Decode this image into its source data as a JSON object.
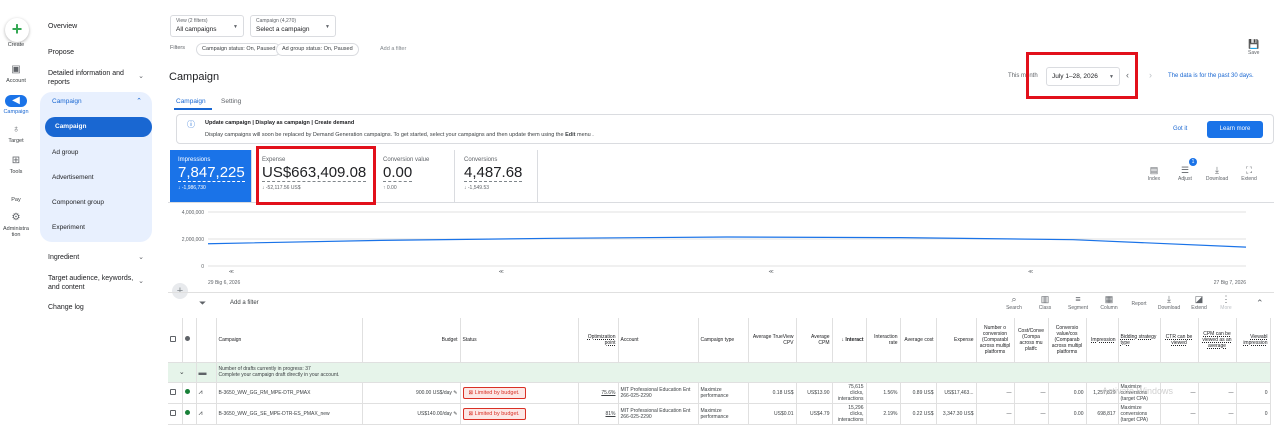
{
  "rail": {
    "create": "Create",
    "items": [
      {
        "label": "Account",
        "icon": "account-icon"
      },
      {
        "label": "Campaign",
        "icon": "campaign-icon"
      },
      {
        "label": "Target",
        "icon": "target-icon"
      },
      {
        "label": "Tools",
        "icon": "tools-icon"
      },
      {
        "label": "Pay",
        "icon": "pay-icon"
      },
      {
        "label": "Administra tion",
        "icon": "admin-icon"
      }
    ]
  },
  "nav": {
    "overview": "Overview",
    "propose": "Propose",
    "detailed": "Detailed information and reports",
    "campaign": "Campaign",
    "sub": [
      "Campaign",
      "Ad group",
      "Advertisement",
      "Component group",
      "Experiment"
    ],
    "ingredient": "Ingredient",
    "target_audience": "Target audience, keywords, and content",
    "change_log": "Change log"
  },
  "header": {
    "view_small": "View (2 filters)",
    "view_value": "All campaigns",
    "campaign_small": "Campaign (4,270)",
    "campaign_value": "Select a campaign",
    "filters_label": "Filters",
    "chip1": "Campaign status: On, Paused",
    "chip2": "Ad group status: On, Paused",
    "add_filter": "Add a filter",
    "save": "Save"
  },
  "page": {
    "title": "Campaign",
    "this_month": "This month",
    "date_range": "July 1–28, 2026",
    "data_note": "The data is for the past 30 days.",
    "tab_campaign": "Campaign",
    "tab_setting": "Setting"
  },
  "banner": {
    "title": "Update campaign | Display as campaign | Create demand",
    "text_a": "Display campaigns will soon be replaced by Demand Generation campaigns. To get started, select your campaigns and then update them using the ",
    "text_bold": "Edit",
    "text_b": " menu .",
    "got_it": "Got it",
    "learn_more": "Learn more"
  },
  "scorecards": [
    {
      "label": "Impressions",
      "value": "7,847,225",
      "delta": "↓ -1,986,730"
    },
    {
      "label": "Expense",
      "value": "US$663,409.08",
      "delta": "↓ -52,117.56 US$"
    },
    {
      "label": "Conversion value",
      "value": "0.00",
      "delta": "↑ 0.00"
    },
    {
      "label": "Conversions",
      "value": "4,487.68",
      "delta": "↓ -1,549.53"
    }
  ],
  "tools": {
    "index": "Index",
    "adjust": "Adjust",
    "adjust_badge": "1",
    "download": "Download",
    "extend": "Extend"
  },
  "chart_data": {
    "type": "line",
    "y_ticks": [
      "4,000,000",
      "2,000,000",
      "0"
    ],
    "ylim": [
      0,
      4000000
    ],
    "x_start": "29 Big 6, 2026",
    "x_end": "27 Big 7, 2026",
    "series": [
      {
        "values": [
          1650000,
          1900000,
          2050000,
          2150000,
          2100000,
          1950000,
          1400000
        ]
      }
    ],
    "color": "#1a73e8",
    "markers": [
      "≪",
      "≪",
      "≪",
      "≪"
    ]
  },
  "table_toolbar": {
    "add_filter": "Add a filter",
    "search": "Search",
    "class": "Class",
    "segment": "Segment",
    "column": "Column",
    "report": "Report",
    "download": "Download",
    "extend": "Extend",
    "more": "More"
  },
  "table": {
    "headers": [
      "Campaign",
      "Budget",
      "Status",
      "Optimization point",
      "Account",
      "Campaign type",
      "Average TrueView CPV",
      "Average CPM",
      "↓ Interact",
      "Interaction rate",
      "Average cost",
      "Expense",
      "Number o conversion (Comparabl across multipl platforms",
      "Cost/Conve (Compa across mu platfc",
      "Conversio value/cos (Comparab across multipl platforms",
      "Impression",
      "Bidding strategy type",
      "CTR can be viewed",
      "CPM can be viewed as an average",
      "Viewabl impression"
    ],
    "draft": {
      "title": "Number of drafts currently in progress: 37",
      "sub": "Complete your campaign draft directly in your account."
    },
    "rows": [
      {
        "campaign": "B-3650_WW_GG_RM_MPE-DTR_PMAX",
        "budget": "900.00 US$/day",
        "status": "Limited by budget.",
        "opt": "75.6%",
        "account": "MIT Professional Education Ent 266-025-2290",
        "type": "Maximize performance",
        "cpv": "0.18 US$",
        "cpm": "US$13.90",
        "interactions": "75,615 clicks, interactions",
        "rate": "1.56%",
        "avg_cost": "0.89 US$",
        "expense": "US$17,463...",
        "conv": "—",
        "cost_conv": "—",
        "conv_val": "0.00",
        "impr": "1,257,829",
        "bidding": "Maximize conversions (target CPA)",
        "ctr": "—",
        "cpm_v": "—",
        "viewable": "0"
      },
      {
        "campaign": "B-3650_WW_GG_SE_MPE-DTR-ES_PMAX_new",
        "budget": "US$140.00/day",
        "status": "Limited by budget.",
        "opt": "81%",
        "account": "MIT Professional Education Ent 266-025-2290",
        "type": "Maximize performance",
        "cpv": "US$0.01",
        "cpm": "US$4.79",
        "interactions": "15,296 clicks, interactions",
        "rate": "2.19%",
        "avg_cost": "0.22 US$",
        "expense": "3,347.30 US$",
        "conv": "—",
        "cost_conv": "—",
        "conv_val": "0.00",
        "impr": "698,817",
        "bidding": "Maximize conversions (target CPA)",
        "ctr": "—",
        "cpm_v": "—",
        "viewable": "0"
      }
    ]
  },
  "watermark": "Activate Windows"
}
